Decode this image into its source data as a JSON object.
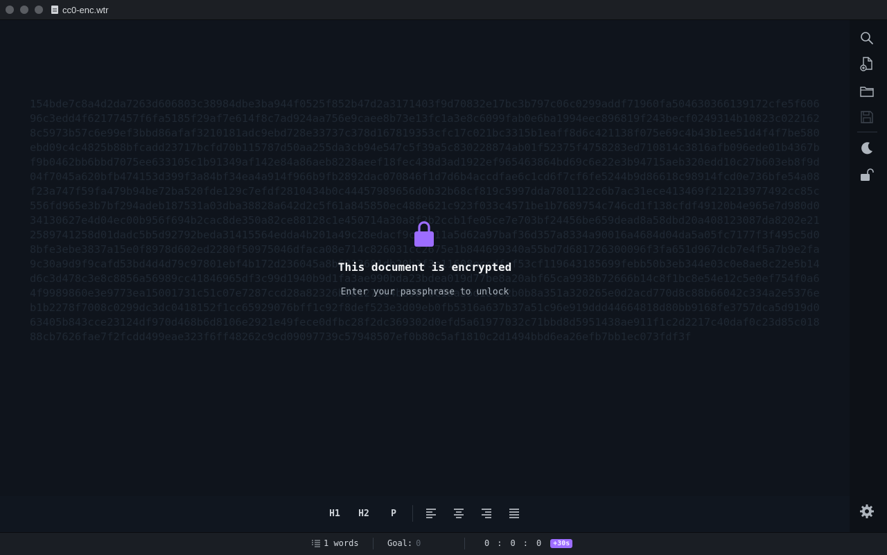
{
  "window": {
    "title": "cc0-enc.wtr"
  },
  "editor": {
    "ciphertext": "154bde7c8a4d2da7263d606803c38984dbe3ba944f0525f852b47d2a3171403f9d70832e17bc3b797c06c0299addf71960fa504630366139172cfe5f60696c3edd4f62177457f6fa5185f29af7e614f8c7ad924aa756e9caee8b73e13fc1a3e8c6099fab0e6ba1994eec896819f243becf0249314b10823c0221628c5973b57c6e99ef3bbd86afaf3210181adc9ebd728e33737c378d167819353cfc17c021bc3315b1eaff8d6c421138f075e69c4b43b1ee51d4f4f7be580ebd09c4c4825b88bfcadd23717bcfd70b115787d50aa255da3cb94e547c5f39a5c830228874ab01f52375f4758283ed710814c3816afb096ede01b4367bf9b0462bb6bbd7075ee633105c1b91349af142e84a86aeb8228aeef18fec438d3ad1922ef965463864bd69c6e22e3b94715aeb320edd10c27b603eb8f9d04f7045a620bfb474153d399f3a84bf34ea4a914f966b9fb2892dac070846f1d7d6b4accdfae6c1cd6f7cf6fe5244b9d86618c98914fcd0e736bfe54a08f23a747f59fa479b94be72ba520fde129c7efdf2810434b0c44457989656d0b32b68cf819c5997dda7801122c6b7ac31ece413469f212213977492cc85c556fd965e3b7bf294adeb187531a03dba38828a642d2c5f61a845850ec488e621c923f033c4571be1b7689754c746cd1f138cfdf49120b4e965e7d980d034130627e4d04ec00b956f694b2cac8de350a82ce88128c1e450714a30a8f2b2ccb1fe05ce7e703bf24456be659dead8a58dbd20a408123087da8202e212589741258d01dadc5b5d92792beda31415564edda4b201a49c28edacf9c3a811a5d62a97baf36d357a8334a90016a4684d04da5a05fc7177f3f495c5d08bfe3ebe3837a15e0f8978d602ed2280f50975046dfaca08e714c826031cc2675e1b844699340a55bd7d681726300096f3fa651d967dcb7e4f5a7b9e2fa9c30a9d9f9cafd53bd4d4d79c97801ebf4b172d236045a8b6813681db20b3f3e11608eccdfaf53cf119643185699febb50b3eb344e03c0e8ae8c22e5b14d6c3d478c3e8c8856a56989cc41846965df3c99d1940b9d1fa3ae990bda23bdea019d77be8a20abf65ca9938b72666b14c8f1bc8e54e12c5e0ef754f0a64f9989860e3e9773ea15001731c51c07e7287ccd28a82326b981275e4b89870c1da35d18902b0b8a351a320265e0d2acd770d8c88b66042c334a2e5376eb1b2278f7008c0299dc3dc0418152f1cc65929076bff1c92f8def523e3d09eb0fb5316a637b37a51c96e919ddd44664818d80bb9168fe3757dca5d919d063405b843cce23124df970d468b6d8106e2921e49fece0dfbc28f2dc369302d0efd5a61977032c71bbd8d5951438ae911f1c2d2217c40daf0c23d85c01888cb7626fae7f2fcdd499eae323f6ff48262c9cd09097739c57948507ef0b80c5af1810c2d1494bbd6ea26efb7bb1ec073fdf3f",
    "lock_title": "This document is encrypted",
    "lock_subtitle": "Enter your passphrase to unlock"
  },
  "format_toolbar": {
    "h1": "H1",
    "h2": "H2",
    "p": "P"
  },
  "statusbar": {
    "word_count": "1 words",
    "goal_label": "Goal:",
    "goal_value": "0",
    "timer_h": "0",
    "timer_m": "0",
    "timer_s": "0",
    "timer_sep": ":",
    "timer_add": "+30s"
  },
  "colors": {
    "accent": "#9d6dff",
    "background": "#0f141c"
  }
}
